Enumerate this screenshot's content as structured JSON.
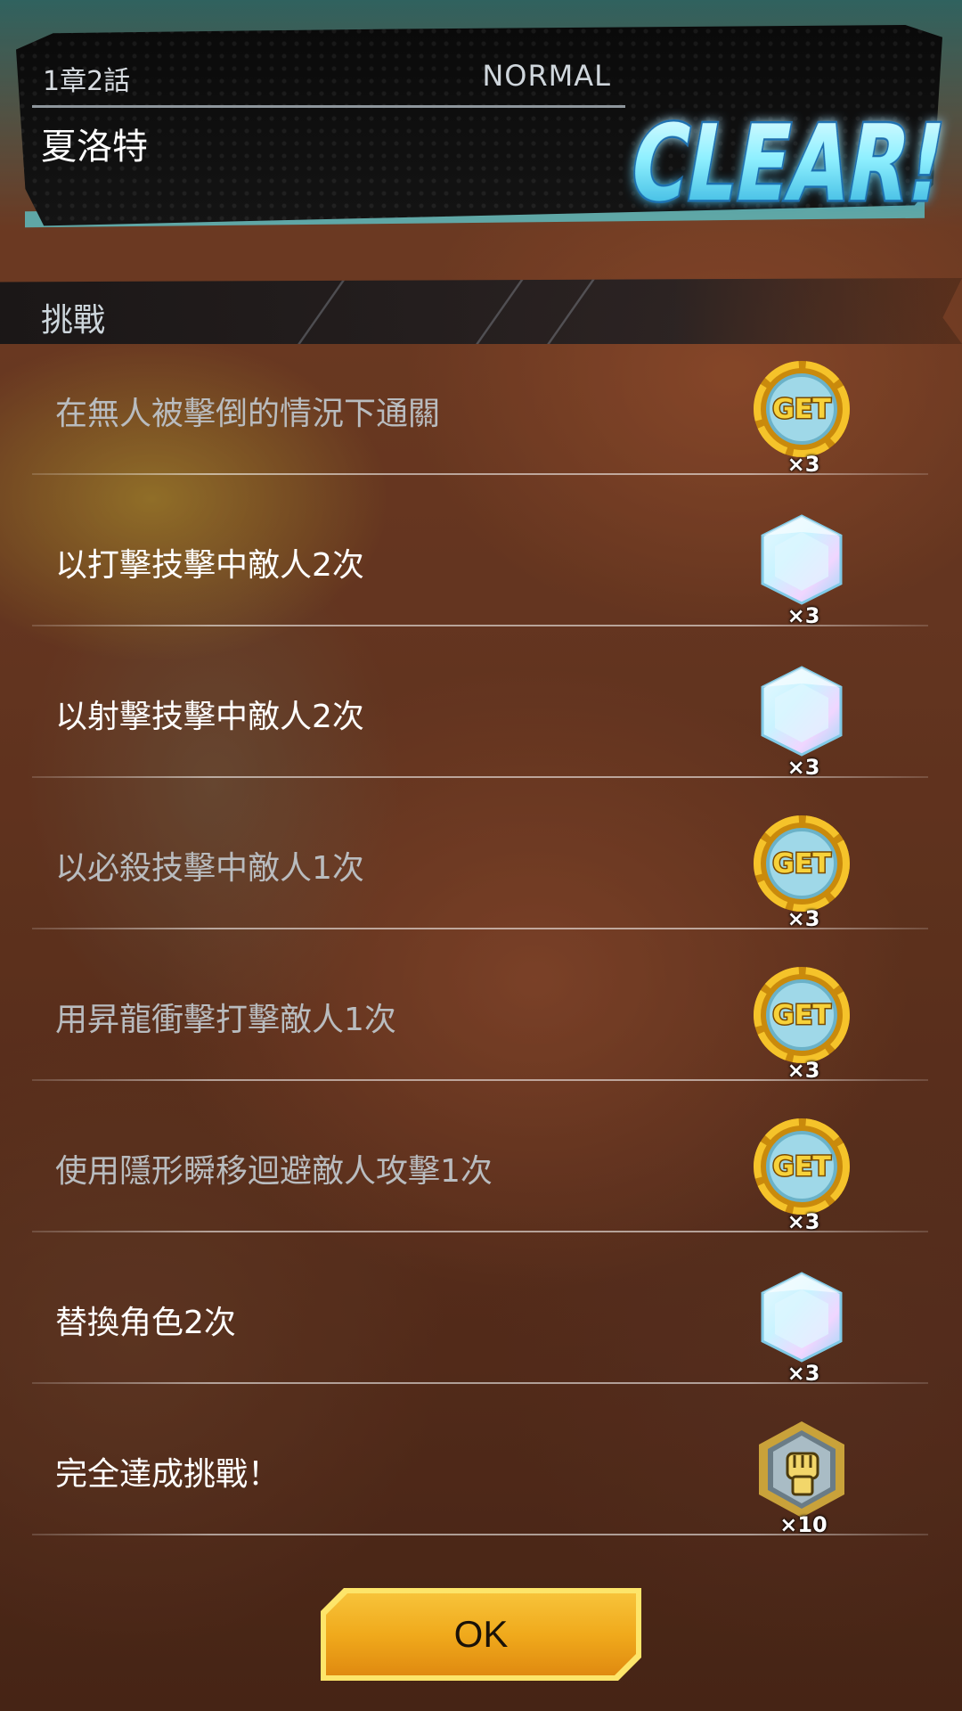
{
  "header": {
    "chapter": "1章2話",
    "difficulty": "NORMAL",
    "stage_name": "夏洛特",
    "clear_text": "CLEAR!"
  },
  "challenges": {
    "title": "挑戰",
    "items": [
      {
        "label": "在無人被擊倒的情況下通關",
        "status": "completed",
        "reward_icon": "get-medal-icon",
        "reward_qty": "×3"
      },
      {
        "label": "以打擊技擊中敵人2次",
        "status": "new",
        "reward_icon": "chrono-crystal-icon",
        "reward_qty": "×3"
      },
      {
        "label": "以射擊技擊中敵人2次",
        "status": "new",
        "reward_icon": "chrono-crystal-icon",
        "reward_qty": "×3"
      },
      {
        "label": "以必殺技擊中敵人1次",
        "status": "completed",
        "reward_icon": "get-medal-icon",
        "reward_qty": "×3"
      },
      {
        "label": "用昇龍衝擊打擊敵人1次",
        "status": "completed",
        "reward_icon": "get-medal-icon",
        "reward_qty": "×3"
      },
      {
        "label": "使用隱形瞬移迴避敵人攻擊1次",
        "status": "completed",
        "reward_icon": "get-medal-icon",
        "reward_qty": "×3"
      },
      {
        "label": "替換角色2次",
        "status": "new",
        "reward_icon": "chrono-crystal-icon",
        "reward_qty": "×3"
      },
      {
        "label": "完全達成挑戰！",
        "status": "new",
        "reward_icon": "fist-medal-icon",
        "reward_qty": "×10"
      }
    ]
  },
  "ok_button": {
    "label": "OK"
  },
  "colors": {
    "accent_gold": "#f0b423",
    "clear_cyan": "#6fe6ff",
    "completed_text": "#b9bcbf",
    "active_text": "#ffffff"
  }
}
